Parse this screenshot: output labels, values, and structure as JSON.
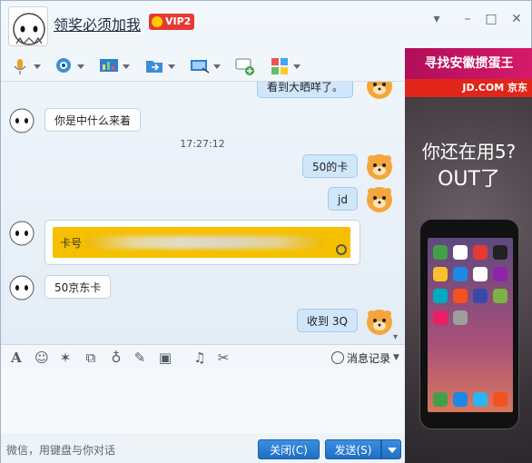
{
  "window": {
    "title": "领奖必须加我",
    "vip_badge": "VIP2",
    "controls": {
      "dropdown": "▾",
      "minimize": "–",
      "maximize": "□",
      "close": "✕"
    }
  },
  "toolbar": {
    "items": [
      {
        "name": "microphone-icon"
      },
      {
        "name": "webcam-icon"
      },
      {
        "name": "screen-share-icon"
      },
      {
        "name": "file-transfer-icon"
      },
      {
        "name": "remote-desktop-icon"
      },
      {
        "name": "chat-add-icon"
      },
      {
        "name": "apps-grid-icon"
      }
    ]
  },
  "chat": {
    "messages": [
      {
        "side": "right",
        "text": "看到大晒咩了。"
      },
      {
        "side": "left",
        "text": "你是中什么来着"
      },
      {
        "side": "right",
        "text": "50的卡"
      },
      {
        "side": "right",
        "text": "jd"
      },
      {
        "side": "left",
        "type": "image",
        "text": "卡号"
      },
      {
        "side": "left",
        "text": "50京东卡"
      },
      {
        "side": "right",
        "text": "收到 3Q"
      }
    ],
    "timestamp": "17:27:12"
  },
  "input_toolbar": {
    "history_label": "消息记录",
    "icons": [
      "font-icon",
      "emoji-icon",
      "magic-icon",
      "shake-icon",
      "voice-icon",
      "edit-icon",
      "image-icon",
      "music-icon",
      "scissors-icon"
    ]
  },
  "bottom": {
    "hint": "微信，用键盘与你对话",
    "close_label": "关闭(C)",
    "send_label": "发送(S)"
  },
  "ad": {
    "headline": "寻找安徽掼蛋王",
    "brand": "JD.COM 京东",
    "line1": "你还在用5?",
    "line2": "OUT了"
  },
  "colors": {
    "accent": "#1f6fc2",
    "right_bubble": "#cfe6fb",
    "ad_header": "#c8145f",
    "jd_red": "#e1251b",
    "card_yellow": "#f6c000"
  }
}
